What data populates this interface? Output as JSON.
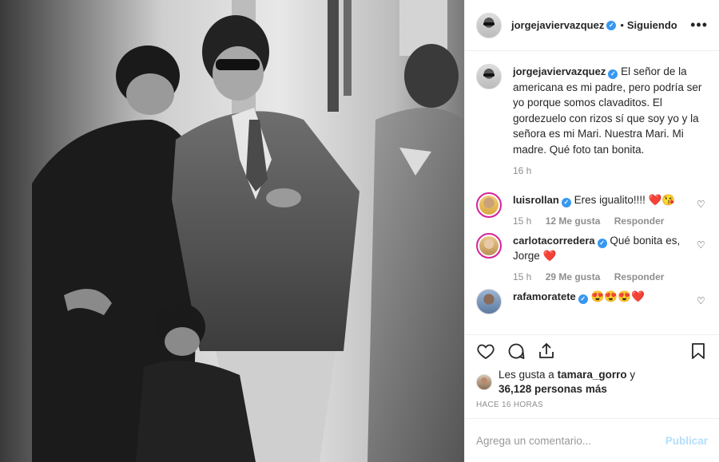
{
  "header": {
    "username": "jorgejaviervazquez",
    "separator": "•",
    "follow_status": "Siguiendo",
    "more_label": "•••"
  },
  "caption": {
    "username": "jorgejaviervazquez",
    "text": "El señor de la americana es mi padre, pero podría ser yo porque somos clavaditos. El gordezuelo con rizos sí que soy yo y la señora es mi Mari. Nuestra Mari. Mi madre. Qué foto tan bonita.",
    "time": "16 h"
  },
  "comments": [
    {
      "username": "luisrollan",
      "text": "Eres igualito!!!! ❤️😘",
      "time": "15 h",
      "likes": "12 Me gusta",
      "reply": "Responder"
    },
    {
      "username": "carlotacorredera",
      "text": "Qué bonita es, Jorge ❤️",
      "time": "15 h",
      "likes": "29 Me gusta",
      "reply": "Responder"
    },
    {
      "username": "rafamoratete",
      "text": "😍😍😍❤️"
    }
  ],
  "likes": {
    "prefix": "Les gusta a",
    "user": "tamara_gorro",
    "connector": "y",
    "count": "36,128 personas más"
  },
  "timestamp": "HACE 16 HORAS",
  "add_comment": {
    "placeholder": "Agrega un comentario...",
    "publish": "Publicar"
  },
  "colors": {
    "verified": "#3897f0",
    "publish_disabled": "#b2dffc",
    "muted": "#8e8e8e",
    "border": "#efefef"
  },
  "icons": [
    "heart-icon",
    "comment-icon",
    "share-icon",
    "bookmark-icon",
    "verified-badge-icon",
    "more-icon"
  ]
}
